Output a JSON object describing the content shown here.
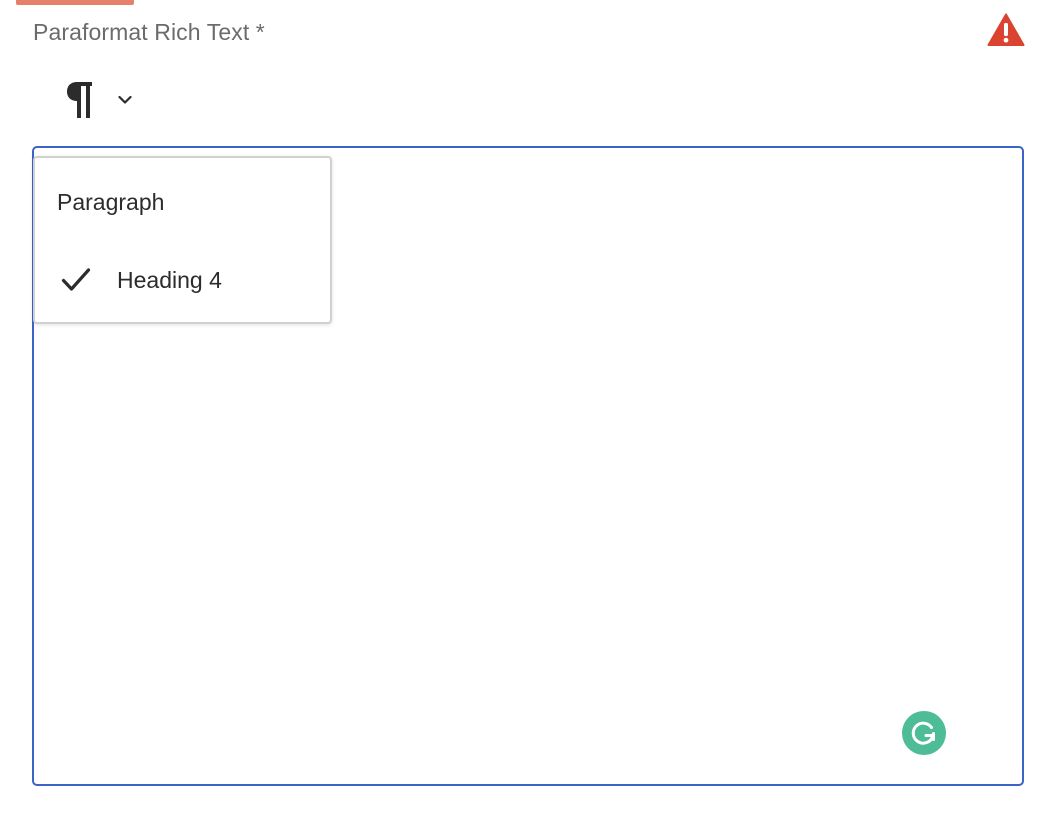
{
  "field": {
    "label": "Paraformat Rich Text *",
    "required": true,
    "status_icon": "alert-icon",
    "accent_color": "#e6806b",
    "alert_color": "#d9432f"
  },
  "toolbar": {
    "format_icon": "pilcrow-icon",
    "dropdown_icon": "chevron-down-icon"
  },
  "dropdown": {
    "items": [
      {
        "label": "Paragraph",
        "selected": false
      },
      {
        "label": "Heading 4",
        "selected": true
      }
    ],
    "selected_icon": "checkmark-icon"
  },
  "editor": {
    "content": "",
    "border_color": "#3b63c8",
    "grammarly_icon": "grammarly-icon",
    "grammarly_color": "#4ebc96"
  }
}
